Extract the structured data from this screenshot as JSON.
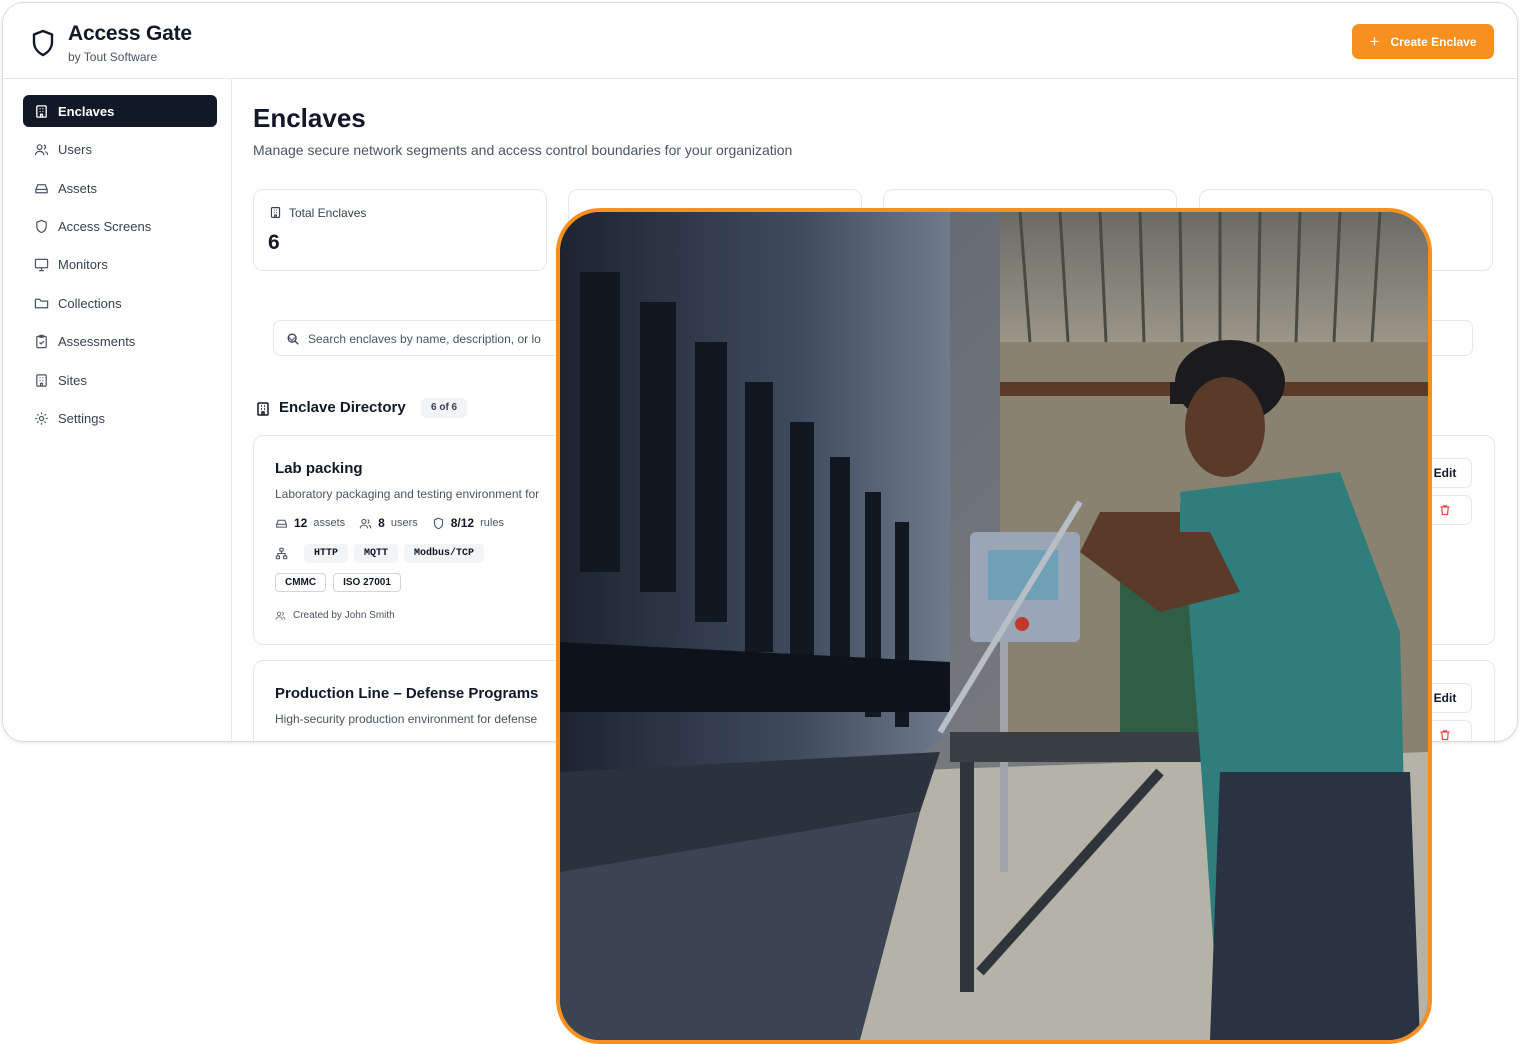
{
  "app": {
    "title": "Access Gate",
    "subtitle": "by Tout Software",
    "create_button": "Create Enclave",
    "accent_color": "#f7901e"
  },
  "sidebar": {
    "items": [
      {
        "label": "Enclaves",
        "icon": "building-icon",
        "active": true
      },
      {
        "label": "Users",
        "icon": "users-icon"
      },
      {
        "label": "Assets",
        "icon": "hard-drive-icon"
      },
      {
        "label": "Access Screens",
        "icon": "shield-icon"
      },
      {
        "label": "Monitors",
        "icon": "monitor-icon"
      },
      {
        "label": "Collections",
        "icon": "folder-icon"
      },
      {
        "label": "Assessments",
        "icon": "clipboard-icon"
      },
      {
        "label": "Sites",
        "icon": "building-icon"
      },
      {
        "label": "Settings",
        "icon": "gear-icon"
      }
    ]
  },
  "page": {
    "title": "Enclaves",
    "subtitle": "Manage secure network segments and access control boundaries for your organization"
  },
  "stats": [
    {
      "label": "Total Enclaves",
      "value": "6",
      "icon": "building-icon"
    }
  ],
  "search": {
    "placeholder": "Search enclaves by name, description, or lo"
  },
  "directory": {
    "title": "Enclave Directory",
    "count_badge": "6 of 6"
  },
  "enclaves": [
    {
      "name": "Lab packing",
      "description": "Laboratory packaging and testing environment for",
      "assets_count": "12",
      "assets_label": "assets",
      "users_count": "8",
      "users_label": "users",
      "rules_count": "8/12",
      "rules_label": "rules",
      "protocols": [
        "HTTP",
        "MQTT",
        "Modbus/TCP"
      ],
      "compliance": [
        "CMMC",
        "ISO 27001"
      ],
      "created_by": "Created by John Smith",
      "edit_label": "Edit"
    },
    {
      "name": "Production Line – Defense Programs",
      "description": "High-security production environment for defense",
      "edit_label": "Edit"
    }
  ]
}
